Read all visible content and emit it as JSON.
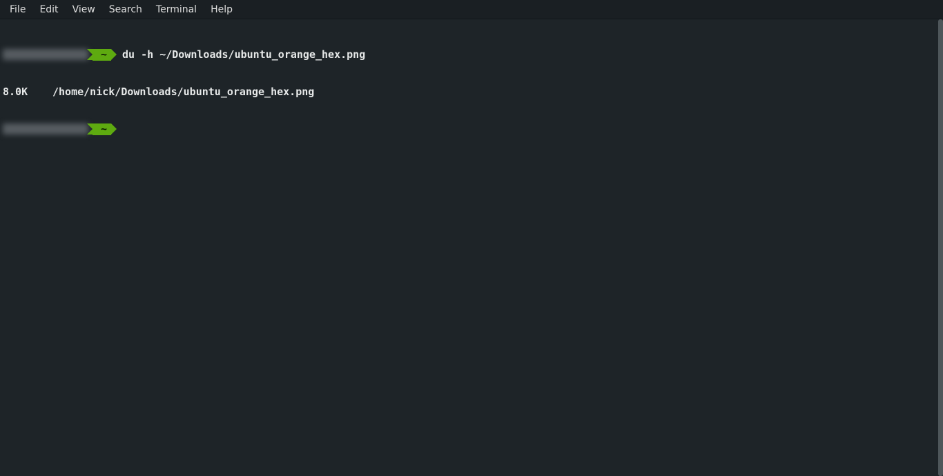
{
  "menubar": {
    "items": [
      "File",
      "Edit",
      "View",
      "Search",
      "Terminal",
      "Help"
    ]
  },
  "prompt": {
    "cwd_tag": "~"
  },
  "lines": {
    "command": "du -h ~/Downloads/ubuntu_orange_hex.png",
    "output_size": "8.0K",
    "output_path": "/home/nick/Downloads/ubuntu_orange_hex.png"
  }
}
